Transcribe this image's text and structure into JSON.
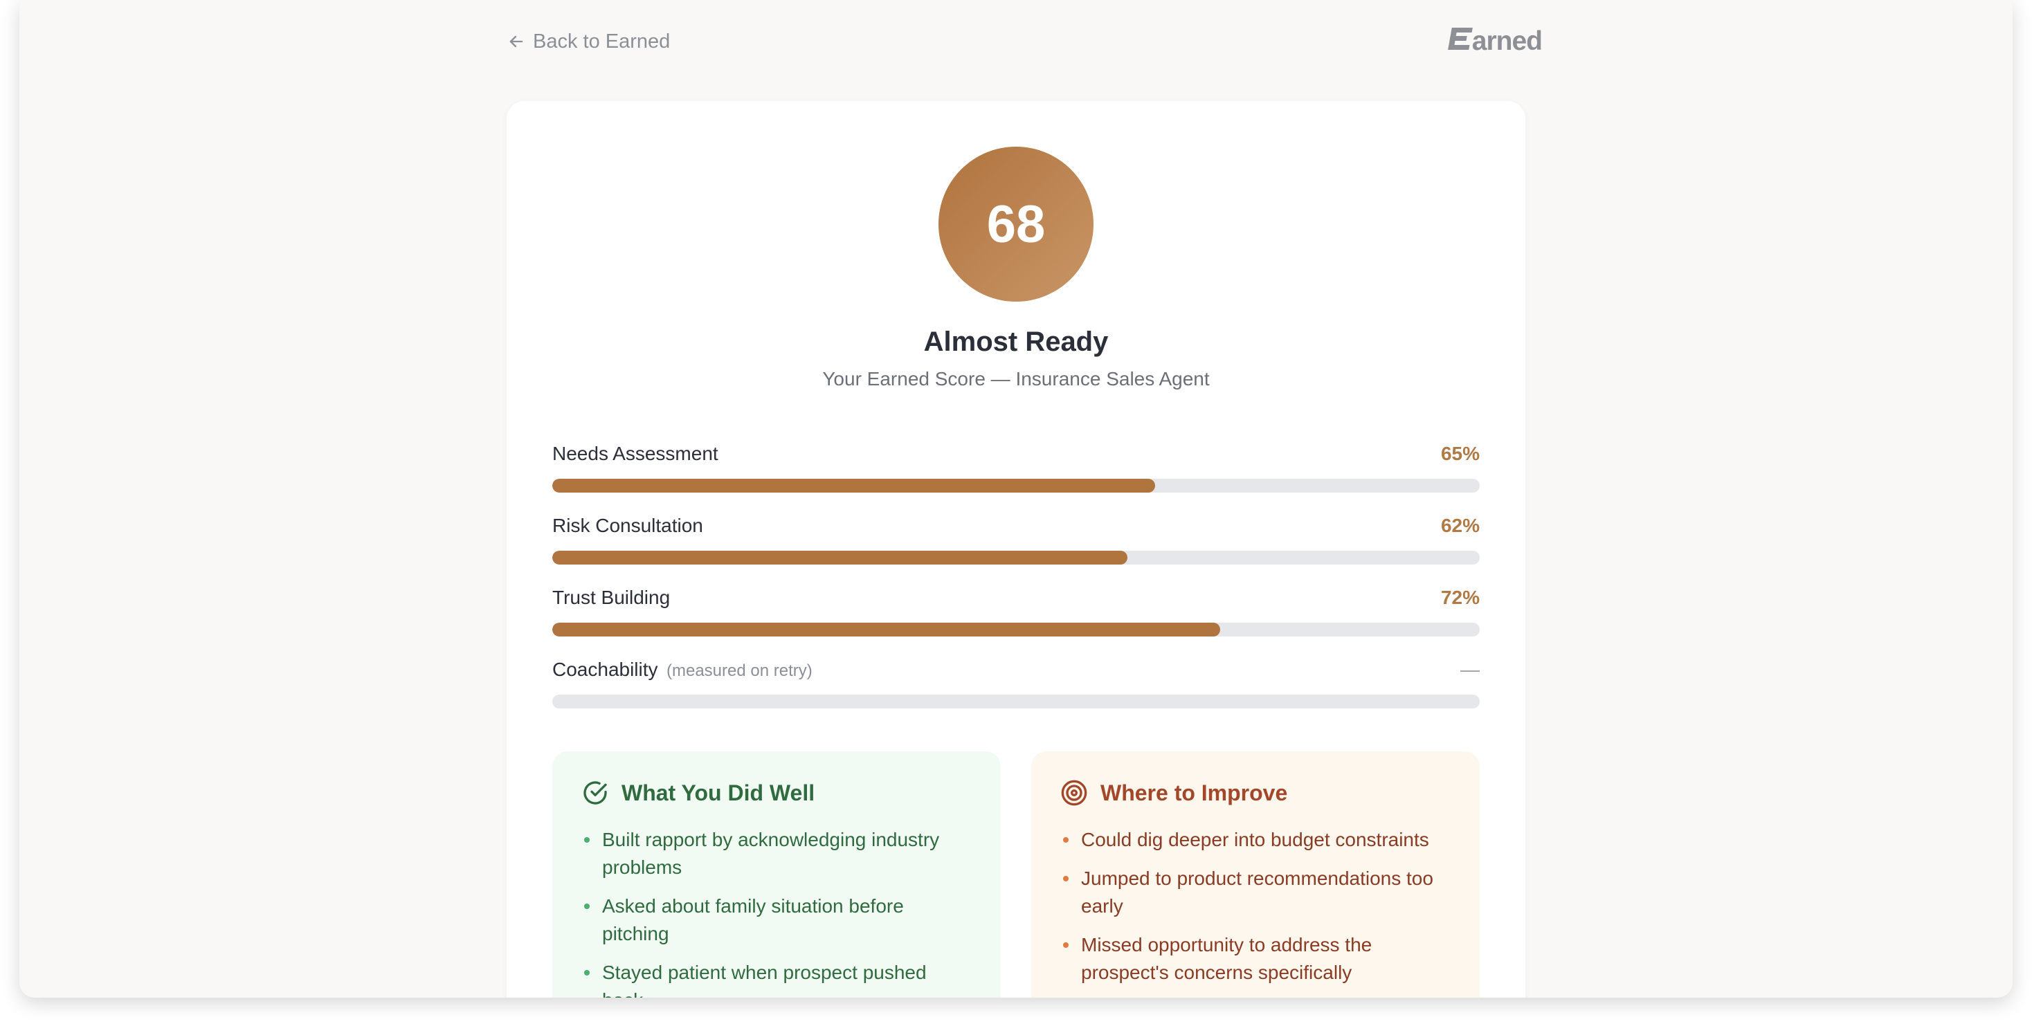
{
  "nav": {
    "back_label": "Back to Earned",
    "logo_text": "arned"
  },
  "score": {
    "value": "68",
    "status": "Almost Ready",
    "subtitle": "Your Earned Score — Insurance Sales Agent"
  },
  "metrics": [
    {
      "label": "Needs Assessment",
      "note": "",
      "value_text": "65%",
      "percent": 65
    },
    {
      "label": "Risk Consultation",
      "note": "",
      "value_text": "62%",
      "percent": 62
    },
    {
      "label": "Trust Building",
      "note": "",
      "value_text": "72%",
      "percent": 72
    },
    {
      "label": "Coachability",
      "note": "(measured on retry)",
      "value_text": "—",
      "percent": 0
    }
  ],
  "well": {
    "title": "What You Did Well",
    "items": [
      "Built rapport by acknowledging industry problems",
      "Asked about family situation before pitching",
      "Stayed patient when prospect pushed back"
    ]
  },
  "improve": {
    "title": "Where to Improve",
    "items": [
      "Could dig deeper into budget constraints",
      "Jumped to product recommendations too early",
      "Missed opportunity to address the prospect's concerns specifically"
    ]
  },
  "colors": {
    "accent": "#b0743f",
    "track": "#e6e7ea",
    "well_bg": "#f1fbf4",
    "improve_bg": "#fdf7ed"
  }
}
